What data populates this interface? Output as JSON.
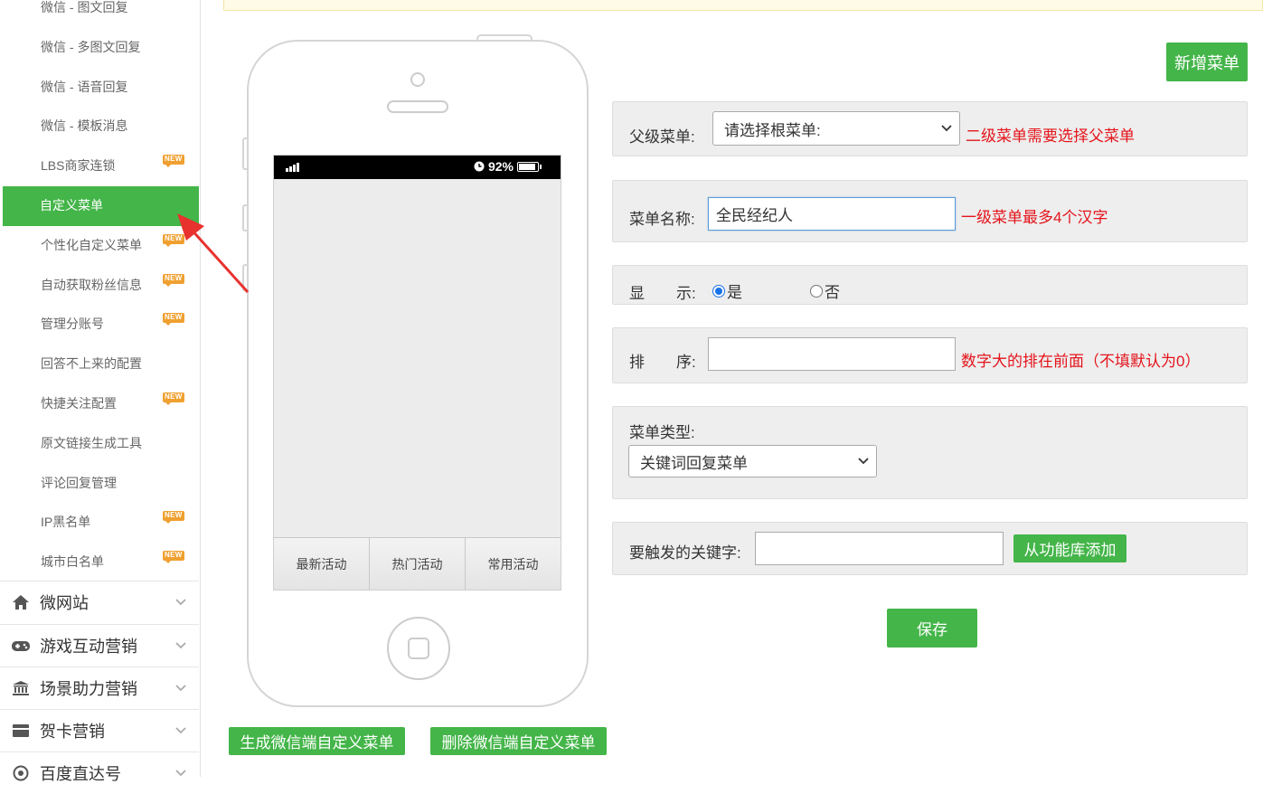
{
  "sidebar": {
    "sub_items": [
      {
        "label": "微信 - 图文回复",
        "badge": ""
      },
      {
        "label": "微信 - 多图文回复",
        "badge": ""
      },
      {
        "label": "微信 - 语音回复",
        "badge": ""
      },
      {
        "label": "微信 - 模板消息",
        "badge": ""
      },
      {
        "label": "LBS商家连锁",
        "badge": "NEW"
      },
      {
        "label": "自定义菜单",
        "badge": "",
        "active": true
      },
      {
        "label": "个性化自定义菜单",
        "badge": "NEW"
      },
      {
        "label": "自动获取粉丝信息",
        "badge": "NEW"
      },
      {
        "label": "管理分账号",
        "badge": "NEW"
      },
      {
        "label": "回答不上来的配置",
        "badge": ""
      },
      {
        "label": "快捷关注配置",
        "badge": "NEW"
      },
      {
        "label": "原文链接生成工具",
        "badge": ""
      },
      {
        "label": "评论回复管理",
        "badge": ""
      },
      {
        "label": "IP黑名单",
        "badge": "NEW"
      },
      {
        "label": "城市白名单",
        "badge": "NEW"
      }
    ],
    "categories": [
      {
        "label": "微网站",
        "icon": "home-icon"
      },
      {
        "label": "游戏互动营销",
        "icon": "gamepad-icon"
      },
      {
        "label": "场景助力营销",
        "icon": "bank-icon"
      },
      {
        "label": "贺卡营销",
        "icon": "card-icon"
      },
      {
        "label": "百度直达号",
        "icon": "location-icon"
      }
    ]
  },
  "phone": {
    "battery": "92%",
    "menu": [
      "最新活动",
      "热门活动",
      "常用活动"
    ]
  },
  "actions": {
    "add_menu": "新增菜单",
    "generate": "生成微信端自定义菜单",
    "delete": "删除微信端自定义菜单",
    "save": "保存",
    "from_library": "从功能库添加"
  },
  "form": {
    "parent_label": "父级菜单:",
    "parent_value": "请选择根菜单:",
    "parent_hint": "二级菜单需要选择父菜单",
    "name_label": "菜单名称:",
    "name_value": "全民经纪人",
    "name_hint": "一级菜单最多4个汉字",
    "show_label_1": "显",
    "show_label_2": "示:",
    "show_yes": "是",
    "show_no": "否",
    "show_selected": "是",
    "order_label_1": "排",
    "order_label_2": "序:",
    "order_value": "",
    "order_hint": "数字大的排在前面（不填默认为0）",
    "type_label": "菜单类型:",
    "type_value": "关键词回复菜单",
    "keyword_label": "要触发的关键字:",
    "keyword_value": ""
  },
  "colors": {
    "accent": "#44b549",
    "hint": "#e4141b",
    "arrow": "#e8322e"
  }
}
